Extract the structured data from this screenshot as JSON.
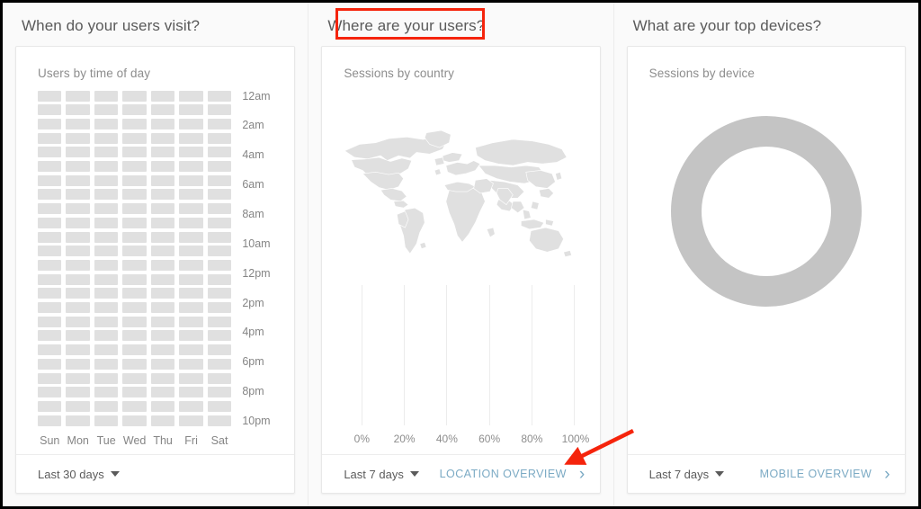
{
  "columns": [
    {
      "title": "When do your users visit?",
      "card": {
        "title": "Users by time of day",
        "footer": {
          "daterange": "Last 30 days",
          "link": null,
          "link_icon": null
        }
      }
    },
    {
      "title": "Where are your users?",
      "card": {
        "title": "Sessions by country",
        "footer": {
          "daterange": "Last 7 days",
          "link": "LOCATION OVERVIEW",
          "link_icon": "chevron-right-icon"
        }
      }
    },
    {
      "title": "What are your top devices?",
      "card": {
        "title": "Sessions by device",
        "footer": {
          "daterange": "Last 7 days",
          "link": "MOBILE OVERVIEW",
          "link_icon": "chevron-right-icon"
        }
      }
    }
  ],
  "chart_data": [
    {
      "type": "heatmap",
      "title": "Users by time of day",
      "xlabel": "",
      "ylabel": "",
      "categories": [
        "Sun",
        "Mon",
        "Tue",
        "Wed",
        "Thu",
        "Fri",
        "Sat"
      ],
      "y_tick_labels": [
        "12am",
        "2am",
        "4am",
        "6am",
        "8am",
        "10am",
        "12pm",
        "2pm",
        "4pm",
        "6pm",
        "8pm",
        "10pm"
      ],
      "rows": 24,
      "cols": 7,
      "values": [],
      "empty_state": true,
      "cell_color": "#e0e0e0",
      "grid": false,
      "legend": "none"
    },
    {
      "type": "bar",
      "title": "Sessions by country",
      "orientation": "horizontal",
      "xlabel": "",
      "ylabel": "",
      "categories": [],
      "values": [],
      "x_tick_labels": [
        "0%",
        "20%",
        "40%",
        "60%",
        "80%",
        "100%"
      ],
      "xlim": [
        0,
        100
      ],
      "empty_state": true,
      "grid": true,
      "grid_color": "#ececec",
      "legend": "none",
      "map": {
        "type": "choropleth-placeholder",
        "fill_color": "#e0e0e0",
        "regions": []
      }
    },
    {
      "type": "pie",
      "subtype": "donut",
      "title": "Sessions by device",
      "labels": [],
      "values": [],
      "empty_state": true,
      "ring_color": "#c4c4c4",
      "legend": "none"
    }
  ],
  "colors": {
    "page_background": "#fafafa",
    "card_background": "#ffffff",
    "annotation_red": "#f5240c",
    "link_blue": "#7baac4",
    "placeholder_grey": "#e0e0e0",
    "donut_grey": "#c4c4c4"
  },
  "annotations": {
    "highlight_box_target": "Where are your users?",
    "arrow_target": "LOCATION OVERVIEW"
  }
}
